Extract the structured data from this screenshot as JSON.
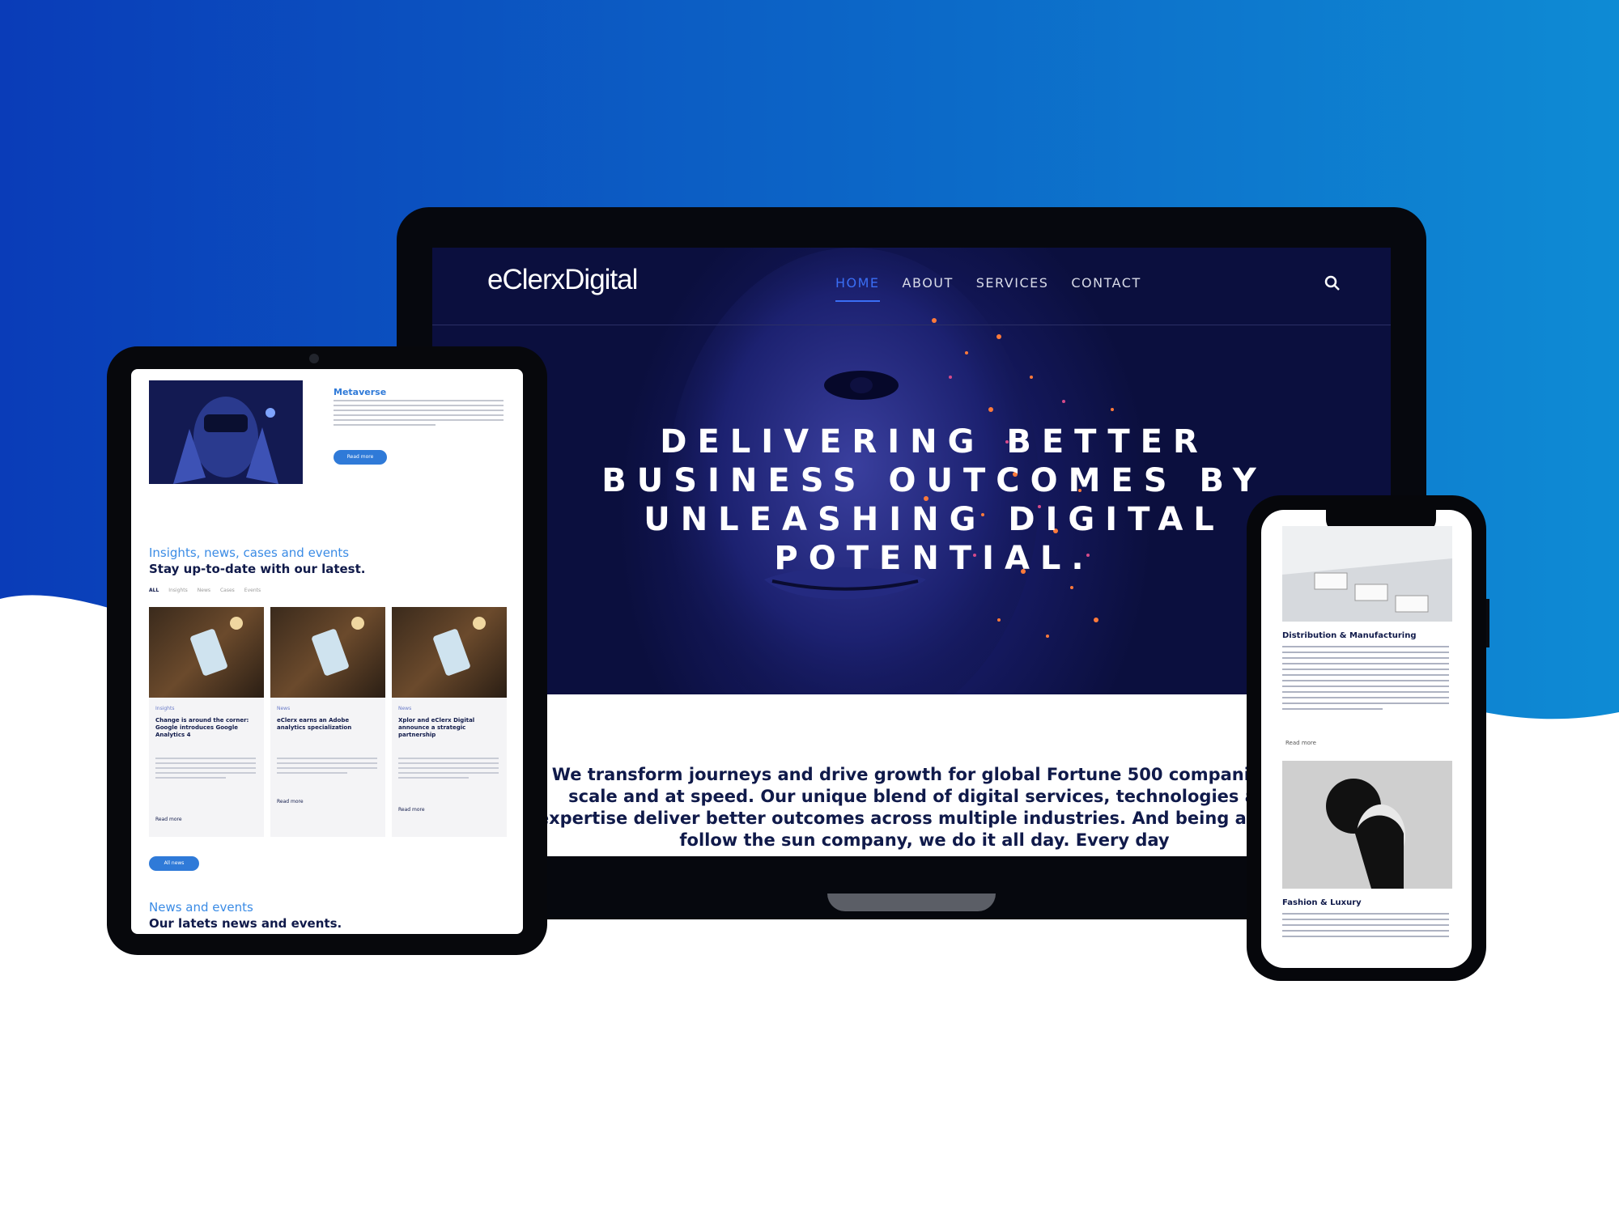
{
  "colors": {
    "bg_gradient_start": "#0a3cb8",
    "bg_gradient_end": "#0e8bd4",
    "hero_bg": "#0b0f3e",
    "accent_blue": "#2f7ad8",
    "text_navy": "#101a4a"
  },
  "laptop": {
    "logo": "eClerxDigital",
    "nav": [
      "HOME",
      "ABOUT",
      "SERVICES",
      "CONTACT"
    ],
    "active_nav": "HOME",
    "search_icon": "search-icon",
    "headline": "DELIVERING BETTER BUSINESS OUTCOMES BY UNLEASHING DIGITAL POTENTIAL.",
    "intro": "We transform journeys and drive growth for global Fortune 500 companies at scale and at speed. Our unique blend of digital services, technologies and expertise deliver better outcomes across multiple industries. And being a global follow the sun company, we do it all day. Every day"
  },
  "tablet": {
    "feature_title": "Metaverse",
    "feature_button": "Read more",
    "section1_title": "Insights, news, cases and events",
    "section1_subtitle": "Stay up-to-date with our latest.",
    "filters": [
      "ALL",
      "Insights",
      "News",
      "Cases",
      "Events"
    ],
    "cards": [
      {
        "tag": "Insights",
        "title": "Change is around the corner: Google introduces Google Analytics 4",
        "more": "Read more"
      },
      {
        "tag": "News",
        "title": "eClerx earns an Adobe analytics specialization",
        "more": "Read more"
      },
      {
        "tag": "News",
        "title": "Xplor and eClerx Digital announce a strategic partnership",
        "more": "Read more"
      }
    ],
    "all_button": "All news",
    "section2_title": "News and events",
    "section2_subtitle": "Our latets news and events."
  },
  "phone": {
    "card1_title": "Distribution & Manufacturing",
    "card1_more": "Read more",
    "card2_title": "Fashion & Luxury"
  }
}
